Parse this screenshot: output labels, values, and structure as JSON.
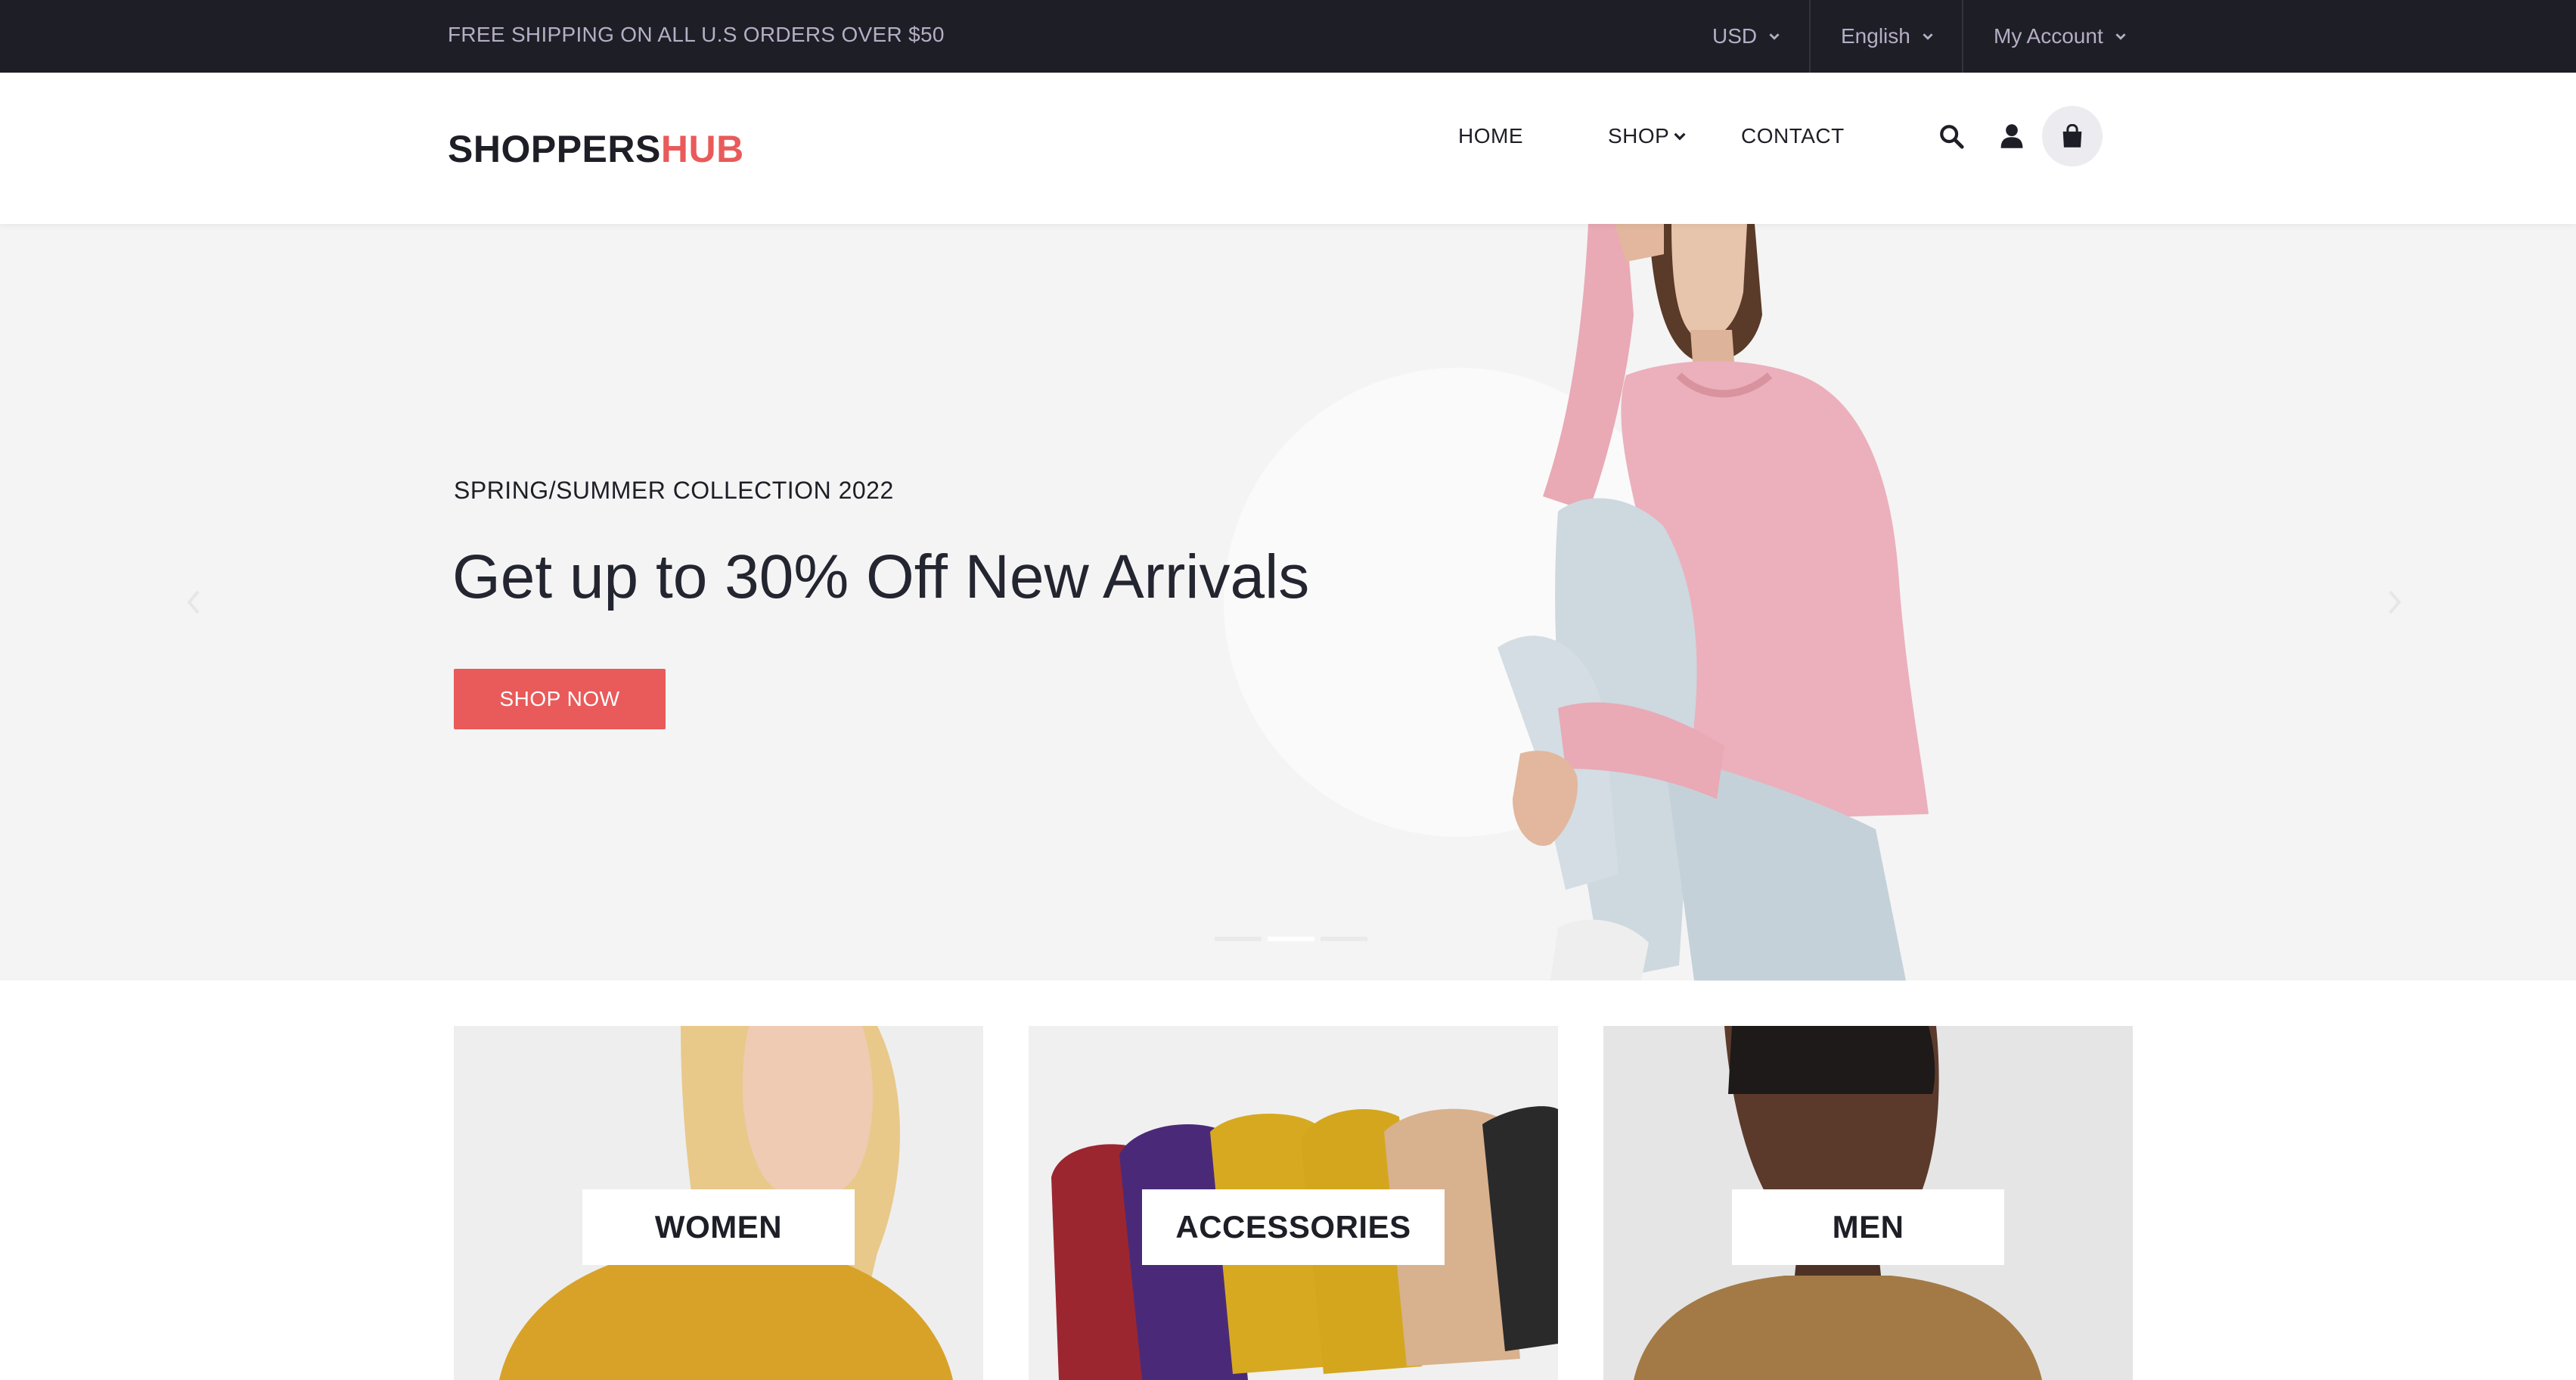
{
  "topbar": {
    "promo": "FREE SHIPPING ON ALL U.S ORDERS OVER $50",
    "currency": "USD",
    "language": "English",
    "account": "My Account"
  },
  "header": {
    "logo_part1": "SHOPPERS",
    "logo_part2": "HUB",
    "nav": {
      "home": "HOME",
      "shop": "SHOP",
      "contact": "CONTACT"
    },
    "icons": [
      "search-icon",
      "user-icon",
      "shopping-bag-icon"
    ]
  },
  "hero": {
    "subtitle": "SPRING/SUMMER COLLECTION 2022",
    "headline": "Get up to 30% Off New Arrivals",
    "button": "SHOP NOW",
    "slides_total": 3,
    "active_slide": 2
  },
  "categories": [
    {
      "label": "WOMEN"
    },
    {
      "label": "ACCESSORIES"
    },
    {
      "label": "MEN"
    }
  ],
  "colors": {
    "topbar_bg": "#1e1e27",
    "accent": "#e95a5a",
    "text_dark": "#1e1e27",
    "hero_bg": "#f4f4f4"
  }
}
